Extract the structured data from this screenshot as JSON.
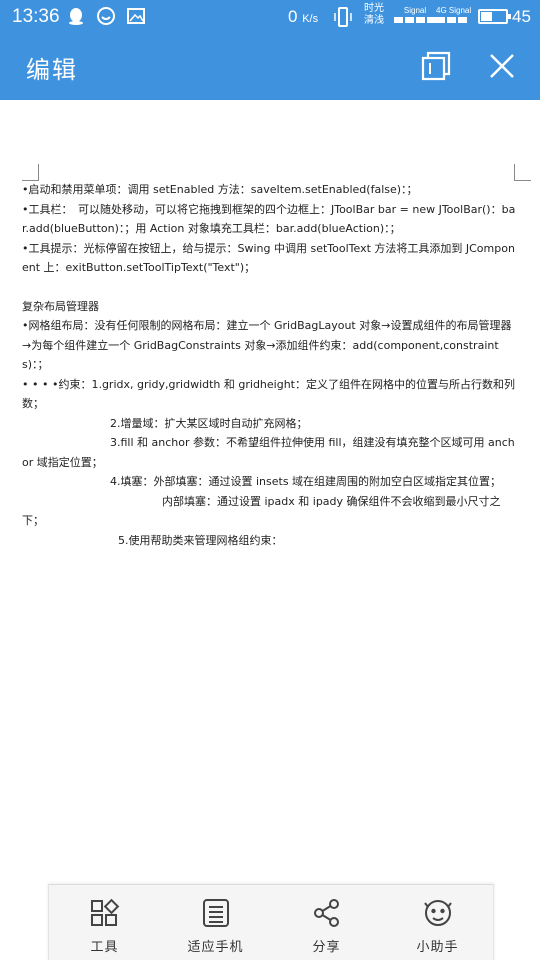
{
  "status_bar": {
    "time": "13:36",
    "net_speed": "0",
    "net_unit": "K/s",
    "carrier_line1": "时光",
    "carrier_line2": "清浅",
    "signal_label_1": "Signal",
    "signal_label_2": "4G Signal",
    "battery_percent": 45,
    "battery_text": "45",
    "icons": [
      "qq-icon",
      "chat-bubble-icon",
      "image-message-icon",
      "vibrate-icon",
      "battery-icon"
    ]
  },
  "header": {
    "title": "编辑",
    "background": "#3f93de",
    "buttons": [
      "copy-icon",
      "close-icon"
    ]
  },
  "document": {
    "lines": [
      "•启动和禁用菜单项：调用 setEnabled 方法：saveItem.setEnabled(false)：；",
      "•工具栏：　可以随处移动，可以将它拖拽到框架的四个边框上：JToolBar bar = new JToolBar()：bar.add(blueButton)：；用 Action 对象填充工具栏：bar.add(blueAction)：；",
      "•工具提示：光标停留在按钮上，给与提示：Swing 中调用 setToolText 方法将工具添加到 JComponent 上：exitButton.setToolTipText(\"Text\")；"
    ],
    "section_title": "复杂布局管理器",
    "grid_lines": [
      "•网格组布局：没有任何限制的网格布局：建立一个 GridBagLayout 对象→设置成组件的布局管理器→为每个组件建立一个 GridBagConstraints 对象→添加组件约束：add(component,constraints)：；",
      "• • • •约束：1.gridx, gridy,gridwidth 和 gridheight：定义了组件在网格中的位置与所占行数和列数；"
    ],
    "item_2": "2.增量域：扩大某区域时自动扩充网格；",
    "item_3": "3.fill 和 anchor 参数：不希望组件拉伸使用 fill，组建没有填充整个区域可用 anchor 域指定位置；",
    "item_4": "4.填塞：外部填塞：通过设置 insets 域在组建周围的附加空白区域指定其位置；",
    "item_4b": "内部填塞：通过设置 ipadx 和 ipady 确保组件不会收缩到最小尺寸之下；",
    "item_5": "5.使用帮助类来管理网格组约束："
  },
  "toolbar": {
    "items": [
      {
        "label": "工具",
        "icon": "tools-grid-icon"
      },
      {
        "label": "适应手机",
        "icon": "fit-phone-icon"
      },
      {
        "label": "分享",
        "icon": "share-icon"
      },
      {
        "label": "小助手",
        "icon": "assistant-icon"
      }
    ]
  }
}
